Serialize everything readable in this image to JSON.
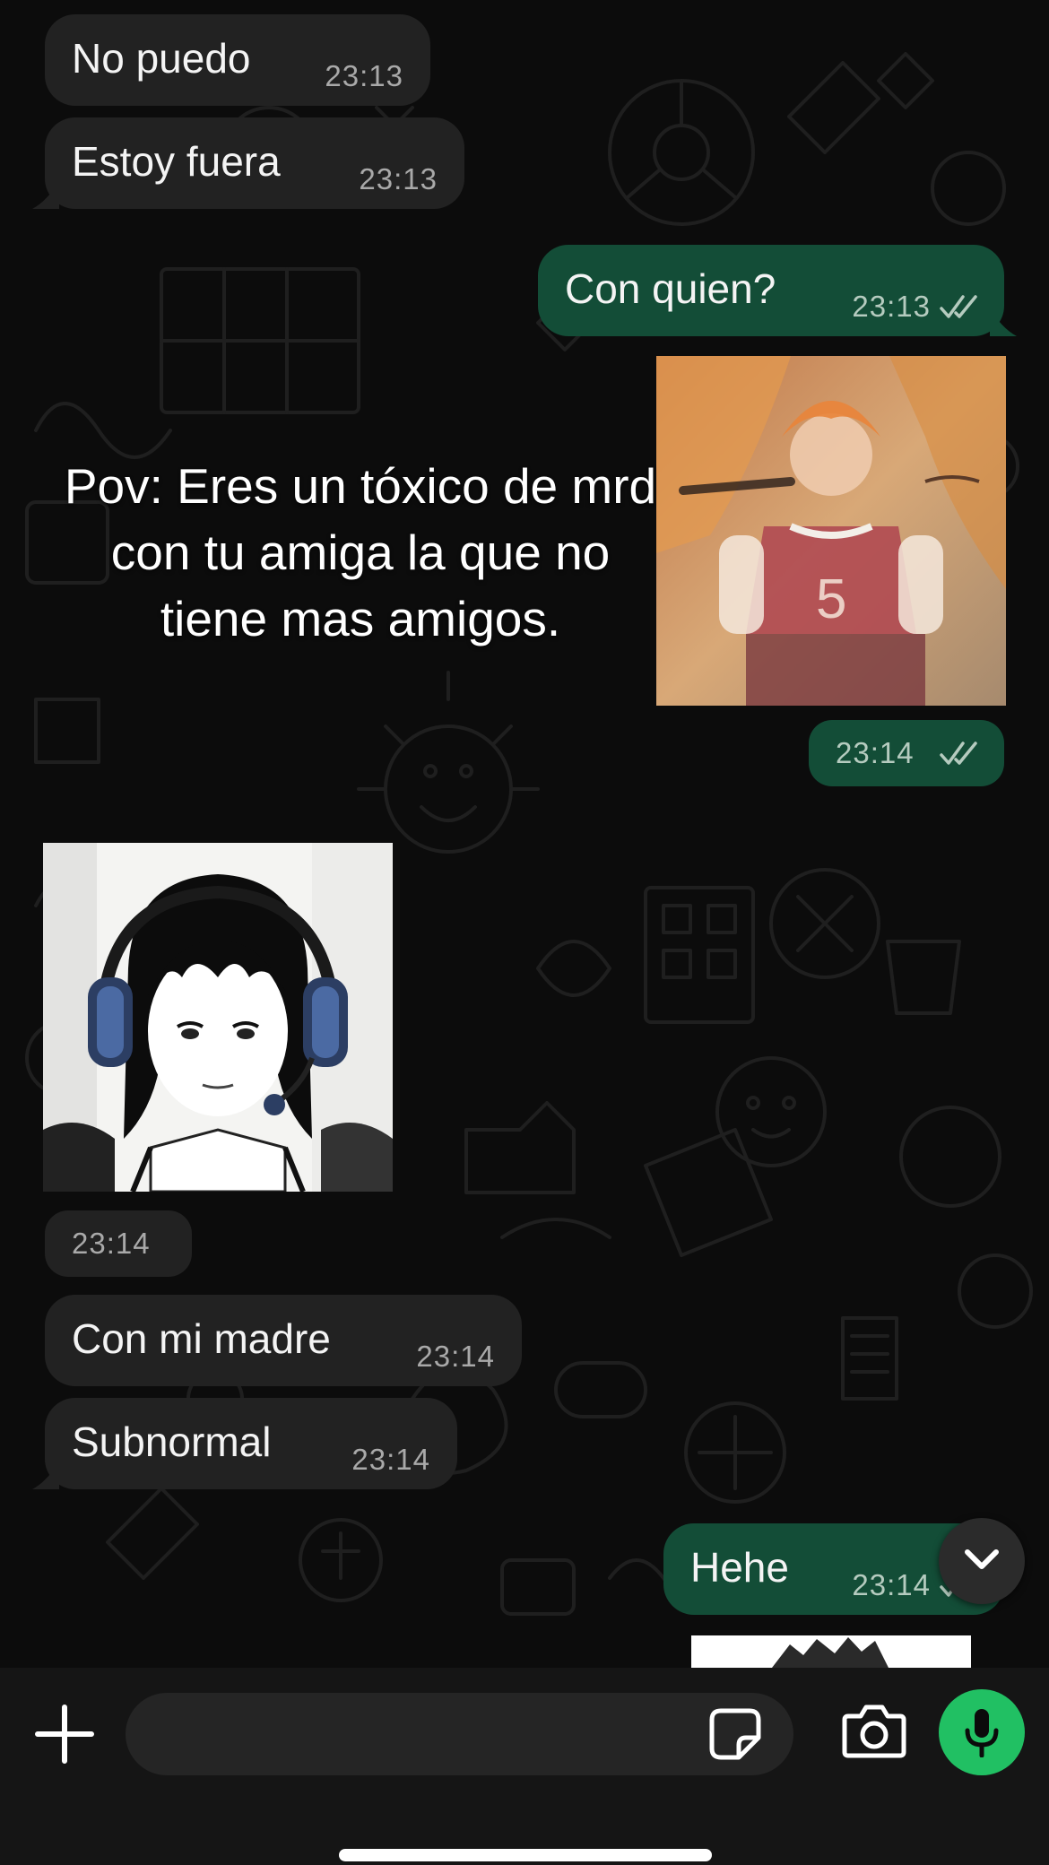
{
  "theme": {
    "incoming_bubble": "#222222",
    "outgoing_bubble": "#134d37",
    "accent_green": "#21c063",
    "read_ticks_color": "#b5cbbf",
    "background": "#0c0c0c"
  },
  "messages": [
    {
      "direction": "in",
      "type": "text",
      "text": "No puedo",
      "time": "23:13"
    },
    {
      "direction": "in",
      "type": "text",
      "text": "Estoy fuera",
      "time": "23:13"
    },
    {
      "direction": "out",
      "type": "text",
      "text": "Con quien?",
      "time": "23:13",
      "status": "read"
    },
    {
      "direction": "out",
      "type": "image",
      "image": "anime boy in red number 5 jersey",
      "time": "23:14",
      "status": "read"
    },
    {
      "direction": "in",
      "type": "image",
      "image": "manga girl with headphones",
      "time": "23:14"
    },
    {
      "direction": "in",
      "type": "text",
      "text": "Con mi madre",
      "time": "23:14"
    },
    {
      "direction": "in",
      "type": "text",
      "text": "Subnormal",
      "time": "23:14"
    },
    {
      "direction": "out",
      "type": "text",
      "text": "Hehe",
      "time": "23:14",
      "status": "read"
    },
    {
      "direction": "out",
      "type": "image",
      "image": "partially visible sketch image"
    }
  ],
  "overlay_caption": "Pov: Eres un tóxico de mrd con tu amiga la que no tiene mas amigos.",
  "composer": {
    "input_value": "",
    "icons": [
      "plus-icon",
      "sticker-icon",
      "camera-icon",
      "microphone-icon"
    ]
  },
  "scroll_button_icon": "chevron-down-icon"
}
